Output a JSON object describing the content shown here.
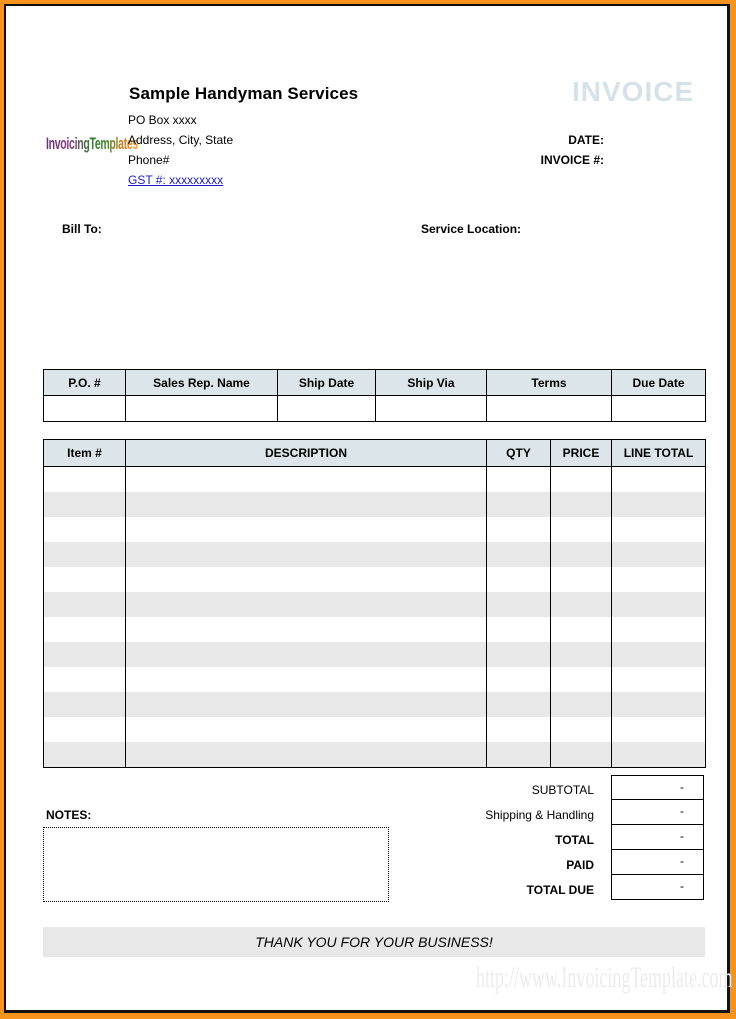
{
  "company": {
    "name": "Sample Handyman Services",
    "logo_text": "InvoicingTemplates",
    "address_lines": [
      "PO Box xxxx",
      "Address, City, State",
      "Phone#"
    ],
    "gst": "GST #: xxxxxxxxx"
  },
  "header": {
    "title": "INVOICE",
    "date_label": "DATE:",
    "date_value": "",
    "invoice_no_label": "INVOICE #:",
    "invoice_no_value": ""
  },
  "parties": {
    "bill_to_label": "Bill To:",
    "service_location_label": "Service Location:"
  },
  "info_table": {
    "headers": [
      "P.O. #",
      "Sales Rep. Name",
      "Ship Date",
      "Ship Via",
      "Terms",
      "Due Date"
    ],
    "values": [
      "",
      "",
      "",
      "",
      "",
      ""
    ]
  },
  "items_table": {
    "headers": [
      "Item #",
      "DESCRIPTION",
      "QTY",
      "PRICE",
      "LINE TOTAL"
    ],
    "rows": [
      [
        "",
        "",
        "",
        "",
        ""
      ],
      [
        "",
        "",
        "",
        "",
        ""
      ],
      [
        "",
        "",
        "",
        "",
        ""
      ],
      [
        "",
        "",
        "",
        "",
        ""
      ],
      [
        "",
        "",
        "",
        "",
        ""
      ],
      [
        "",
        "",
        "",
        "",
        ""
      ],
      [
        "",
        "",
        "",
        "",
        ""
      ],
      [
        "",
        "",
        "",
        "",
        ""
      ],
      [
        "",
        "",
        "",
        "",
        ""
      ],
      [
        "",
        "",
        "",
        "",
        ""
      ],
      [
        "",
        "",
        "",
        "",
        ""
      ],
      [
        "",
        "",
        "",
        "",
        ""
      ]
    ]
  },
  "totals": [
    {
      "label": "SUBTOTAL",
      "value": "-",
      "bold": false
    },
    {
      "label": "Shipping & Handling",
      "value": "-",
      "bold": false
    },
    {
      "label": "TOTAL",
      "value": "-",
      "bold": true
    },
    {
      "label": "PAID",
      "value": "-",
      "bold": true
    },
    {
      "label": "TOTAL DUE",
      "value": "-",
      "bold": true
    }
  ],
  "notes": {
    "label": "NOTES:",
    "value": ""
  },
  "footer": {
    "thanks": "THANK YOU FOR YOUR BUSINESS!",
    "watermark": "http://www.InvoicingTemplate.com"
  },
  "colors": {
    "page_border": "#f7941d",
    "header_fill": "#dce6ea",
    "row_alt_fill": "#e8e8e8",
    "title_color": "#d6e1e8",
    "link_color": "#1a1acc"
  }
}
